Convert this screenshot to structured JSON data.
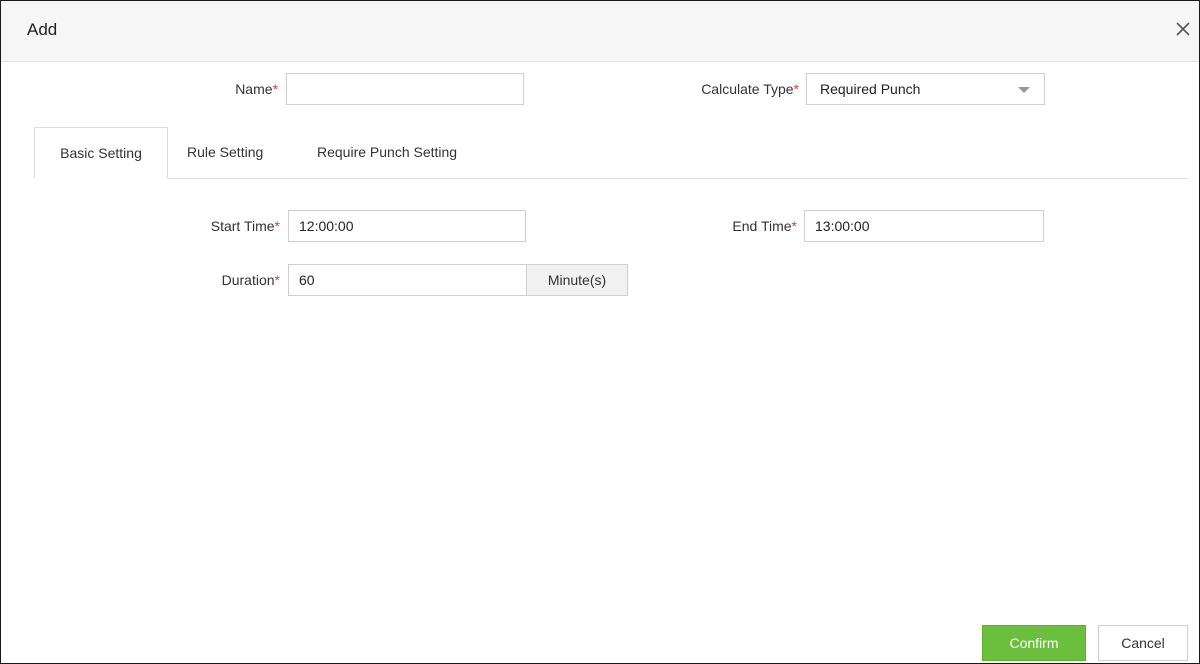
{
  "dialog": {
    "title": "Add",
    "close_icon": "close-icon"
  },
  "form": {
    "name": {
      "label": "Name",
      "required_mark": "*",
      "value": ""
    },
    "calculate_type": {
      "label": "Calculate Type",
      "required_mark": "*",
      "selected": "Required Punch"
    }
  },
  "tabs": [
    {
      "label": "Basic Setting",
      "active": true
    },
    {
      "label": "Rule Setting",
      "active": false
    },
    {
      "label": "Require Punch Setting",
      "active": false
    }
  ],
  "basic": {
    "start_time": {
      "label": "Start Time",
      "required_mark": "*",
      "value": "12:00:00"
    },
    "end_time": {
      "label": "End Time",
      "required_mark": "*",
      "value": "13:00:00"
    },
    "duration": {
      "label": "Duration",
      "required_mark": "*",
      "value": "60",
      "unit": "Minute(s)"
    }
  },
  "buttons": {
    "confirm": "Confirm",
    "cancel": "Cancel"
  },
  "colors": {
    "confirm_bg": "#6cbf3e",
    "required": "#e23b3b"
  }
}
